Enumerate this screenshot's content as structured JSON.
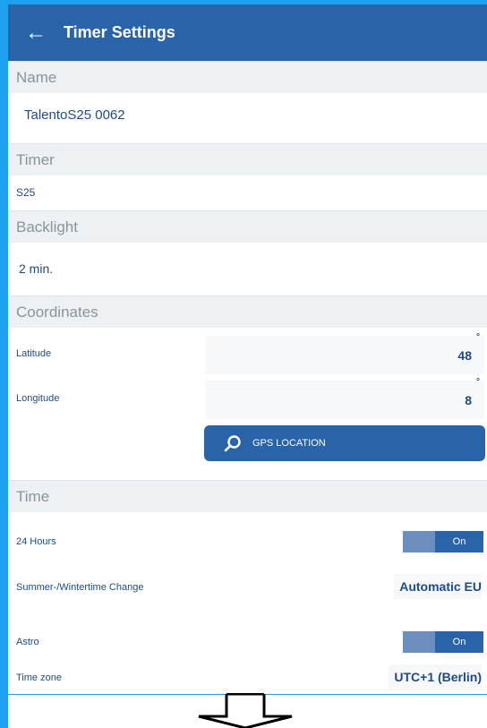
{
  "appbar": {
    "back_icon": "arrow-left-icon",
    "title": "Timer Settings"
  },
  "sections": {
    "name": "Name",
    "timer": "Timer",
    "backlight": "Backlight",
    "coordinates": "Coordinates",
    "time": "Time"
  },
  "name_value": "TalentoS25 0062",
  "timer_value": "S25",
  "backlight_value": "2 min.",
  "coordinates": {
    "latitude_label": "Latitude",
    "latitude_value": "48",
    "longitude_label": "Longitude",
    "longitude_value": "8",
    "degree_symbol": "°",
    "gps_button": "GPS LOCATION",
    "gps_icon": "search-icon"
  },
  "time": {
    "hours24_label": "24 Hours",
    "hours24_state": "On",
    "summer_label": "Summer-/Wintertime Change",
    "summer_value": "Automatic EU",
    "astro_label": "Astro",
    "astro_state": "On",
    "timezone_label": "Time zone",
    "timezone_value": "UTC+1 (Berlin)"
  },
  "colors": {
    "appbar": "#2a64a8",
    "frame": "#1da1ef",
    "section_bg": "#eef1f4",
    "text_blue": "#1e4a85"
  }
}
